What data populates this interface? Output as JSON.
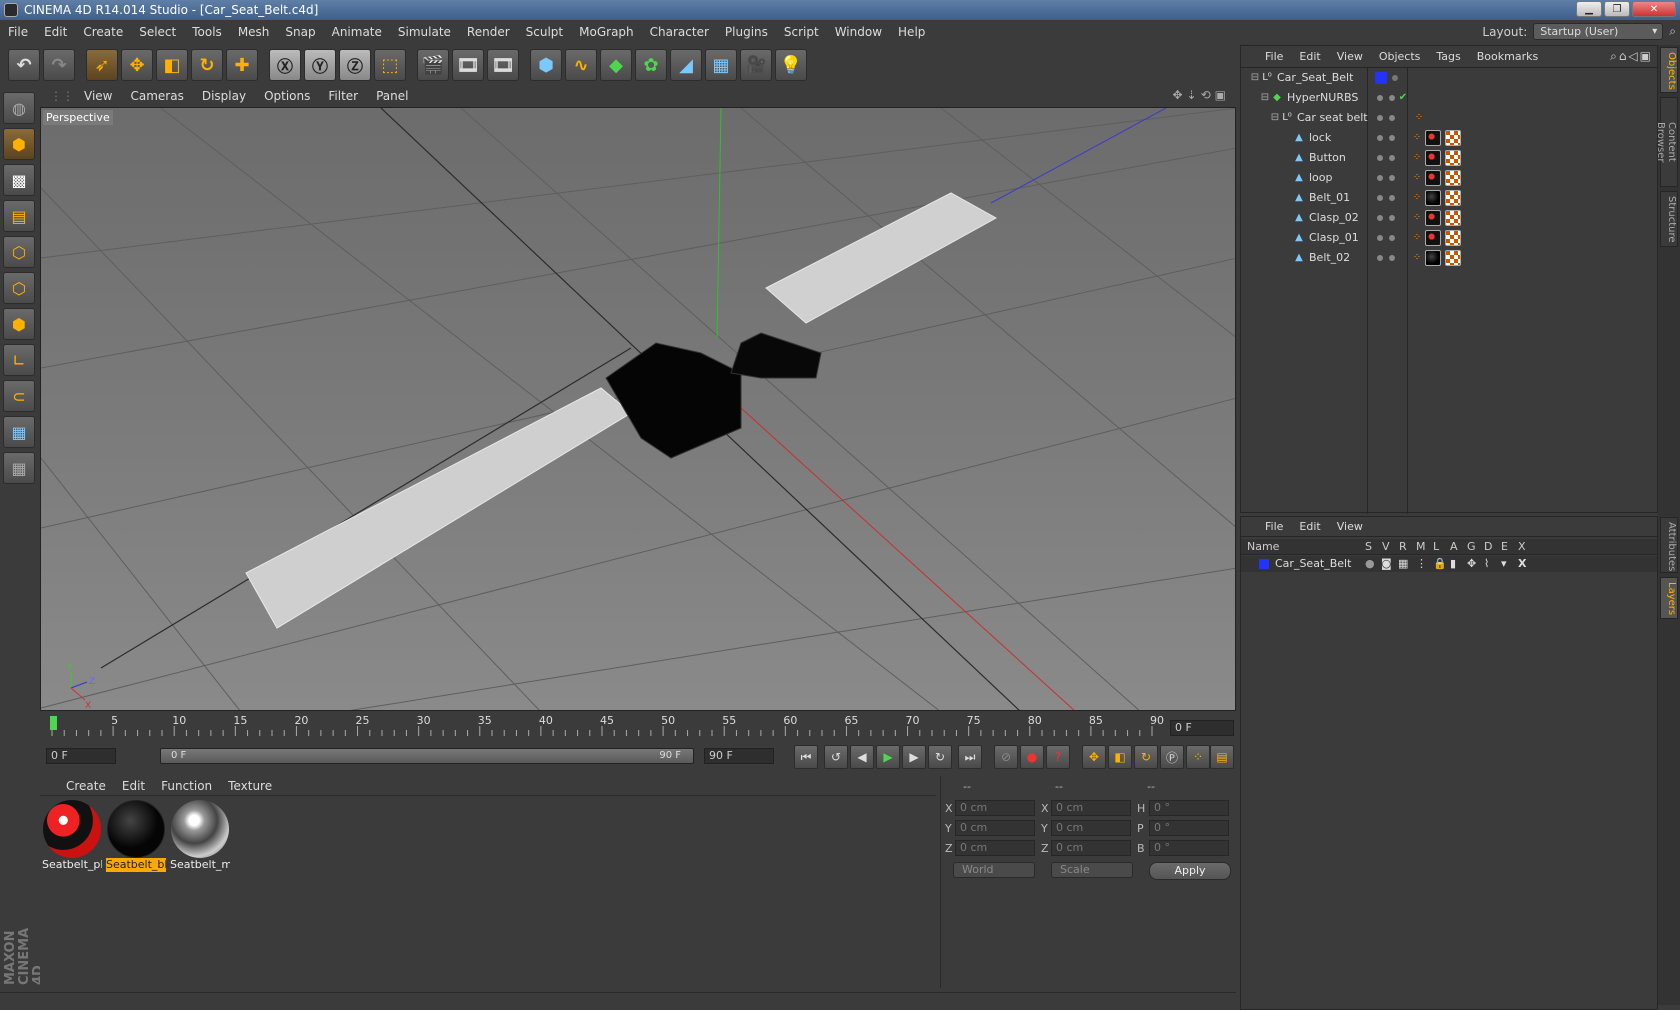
{
  "window": {
    "title": "CINEMA 4D R14.014 Studio - [Car_Seat_Belt.c4d]"
  },
  "menubar": {
    "items": [
      "File",
      "Edit",
      "Create",
      "Select",
      "Tools",
      "Mesh",
      "Snap",
      "Animate",
      "Simulate",
      "Render",
      "Sculpt",
      "MoGraph",
      "Character",
      "Plugins",
      "Script",
      "Window",
      "Help"
    ],
    "layout_label": "Layout:",
    "layout_value": "Startup (User)"
  },
  "viewport": {
    "menu": [
      "View",
      "Cameras",
      "Display",
      "Options",
      "Filter",
      "Panel"
    ],
    "label": "Perspective"
  },
  "timeline": {
    "ticks": [
      "0",
      "5",
      "10",
      "15",
      "20",
      "25",
      "30",
      "35",
      "40",
      "45",
      "50",
      "55",
      "60",
      "65",
      "70",
      "75",
      "80",
      "85",
      "90"
    ],
    "current_frame": "0 F",
    "start": "0 F",
    "range_start": "0 F",
    "range_end": "90 F",
    "end": "90 F"
  },
  "materials": {
    "menu": [
      "Create",
      "Edit",
      "Function",
      "Texture"
    ],
    "items": [
      {
        "label": "Seatbelt_pl",
        "selected": false
      },
      {
        "label": "Seatbelt_bl",
        "selected": true
      },
      {
        "label": "Seatbelt_m",
        "selected": false
      }
    ]
  },
  "coords": {
    "headers": [
      "--",
      "--",
      "--"
    ],
    "rows": [
      {
        "a": "X",
        "av": "0 cm",
        "b": "X",
        "bv": "0 cm",
        "c": "H",
        "cv": "0 °"
      },
      {
        "a": "Y",
        "av": "0 cm",
        "b": "Y",
        "bv": "0 cm",
        "c": "P",
        "cv": "0 °"
      },
      {
        "a": "Z",
        "av": "0 cm",
        "b": "Z",
        "bv": "0 cm",
        "c": "B",
        "cv": "0 °"
      }
    ],
    "world": "World",
    "scale": "Scale",
    "apply": "Apply"
  },
  "objects": {
    "menu": [
      "File",
      "Edit",
      "View",
      "Objects",
      "Tags",
      "Bookmarks"
    ],
    "items": [
      {
        "name": "Car_Seat_Belt",
        "type": "null"
      },
      {
        "name": "HyperNURBS",
        "type": "hypernurbs"
      },
      {
        "name": "Car seat belt",
        "type": "null"
      },
      {
        "name": "lock",
        "type": "poly"
      },
      {
        "name": "Button",
        "type": "poly"
      },
      {
        "name": "loop",
        "type": "poly"
      },
      {
        "name": "Belt_01",
        "type": "poly"
      },
      {
        "name": "Clasp_02",
        "type": "poly"
      },
      {
        "name": "Clasp_01",
        "type": "poly"
      },
      {
        "name": "Belt_02",
        "type": "poly"
      }
    ]
  },
  "layers": {
    "menu": [
      "File",
      "Edit",
      "View"
    ],
    "header": {
      "name": "Name",
      "cols": [
        "S",
        "V",
        "R",
        "M",
        "L",
        "A",
        "G",
        "D",
        "E",
        "X"
      ]
    },
    "row": {
      "name": "Car_Seat_Belt",
      "color": "#2233ff"
    }
  },
  "vtabs": [
    "Objects",
    "Content Browser",
    "Structure",
    "Attributes",
    "Layers"
  ],
  "brand": "MAXON CINEMA 4D",
  "colors": {
    "accent": "#ffb100",
    "selection": "#ffa800",
    "layer": "#2233ff"
  }
}
